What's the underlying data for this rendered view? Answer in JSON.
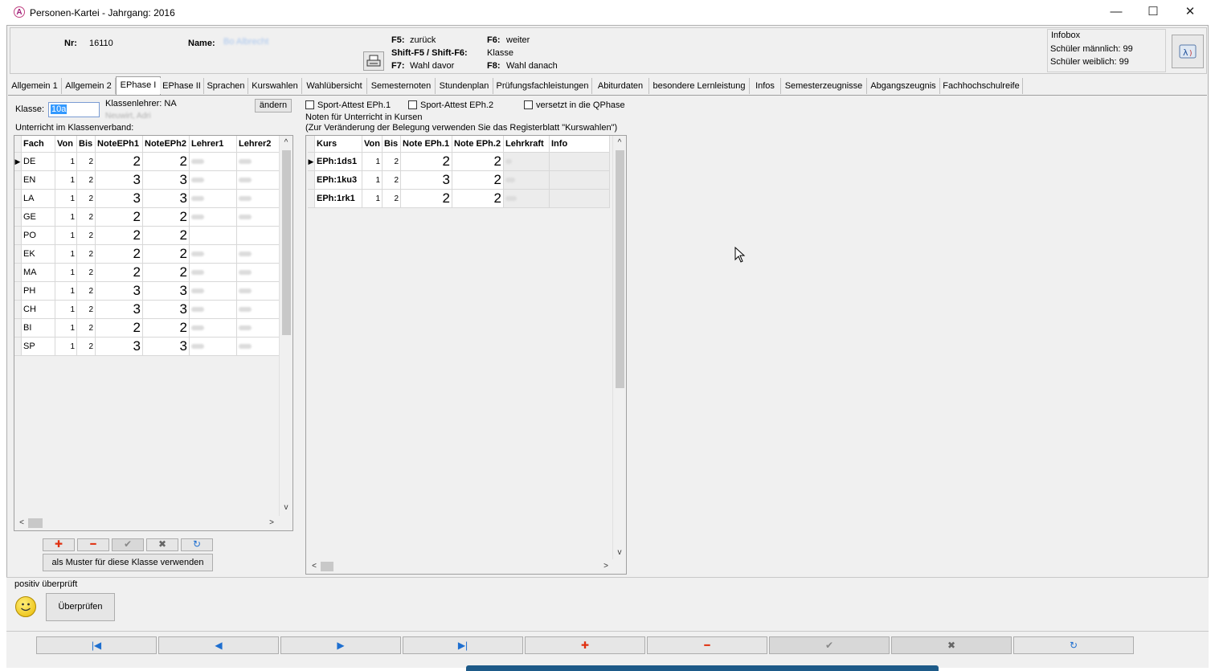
{
  "window": {
    "title": "Personen-Kartei - Jahrgang: 2016",
    "app_icon": "A",
    "minimize_icon": "—",
    "maximize_icon": "☐",
    "close_icon": "✕"
  },
  "header": {
    "nr_label": "Nr:",
    "nr_value": "16110",
    "name_label": "Name:",
    "name_value": "Bo Albrecht",
    "shortcuts": {
      "f5_key": "F5:",
      "f5_text": "zurück",
      "f6_key": "F6:",
      "f6_text": "weiter",
      "shift_key": "Shift-F5 / Shift-F6:",
      "shift_text": "Klasse",
      "f7_key": "F7:",
      "f7_text": "Wahl davor",
      "f8_key": "F8:",
      "f8_text": "Wahl danach"
    },
    "infobox": {
      "title": "Infobox",
      "male": "Schüler männlich: 99",
      "female": "Schüler weiblich: 99"
    }
  },
  "tabs": [
    "Allgemein 1",
    "Allgemein 2",
    "EPhase I",
    "EPhase II",
    "Sprachen",
    "Kurswahlen",
    "Wahlübersicht",
    "Semesternoten",
    "Stundenplan",
    "Prüfungsfachleistungen",
    "Abiturdaten",
    "besondere Lernleistung",
    "Infos",
    "Semesterzeugnisse",
    "Abgangszeugnis",
    "Fachhochschulreife"
  ],
  "active_tab": "EPhase I",
  "left": {
    "klasse_label": "Klasse:",
    "klasse_value": "10a",
    "klassenlehrer_label": "Klassenlehrer: NA",
    "klassenlehrer_sub": "Neuwirt, Adri",
    "aendern_label": "ändern",
    "section_label": "Unterricht im Klassenverband:",
    "columns": [
      "Fach",
      "Von",
      "Bis",
      "NoteEPh1",
      "NoteEPh2",
      "Lehrer1",
      "Lehrer2"
    ],
    "rows": [
      {
        "fach": "DE",
        "von": "1",
        "bis": "2",
        "n1": "2",
        "n2": "2"
      },
      {
        "fach": "EN",
        "von": "1",
        "bis": "2",
        "n1": "3",
        "n2": "3"
      },
      {
        "fach": "LA",
        "von": "1",
        "bis": "2",
        "n1": "3",
        "n2": "3"
      },
      {
        "fach": "GE",
        "von": "1",
        "bis": "2",
        "n1": "2",
        "n2": "2"
      },
      {
        "fach": "PO",
        "von": "1",
        "bis": "2",
        "n1": "2",
        "n2": "2"
      },
      {
        "fach": "EK",
        "von": "1",
        "bis": "2",
        "n1": "2",
        "n2": "2"
      },
      {
        "fach": "MA",
        "von": "1",
        "bis": "2",
        "n1": "2",
        "n2": "2"
      },
      {
        "fach": "PH",
        "von": "1",
        "bis": "2",
        "n1": "3",
        "n2": "3"
      },
      {
        "fach": "CH",
        "von": "1",
        "bis": "2",
        "n1": "3",
        "n2": "3"
      },
      {
        "fach": "BI",
        "von": "1",
        "bis": "2",
        "n1": "2",
        "n2": "2"
      },
      {
        "fach": "SP",
        "von": "1",
        "bis": "2",
        "n1": "3",
        "n2": "3"
      }
    ],
    "muster_label": "als Muster für diese Klasse verwenden"
  },
  "right": {
    "sport1_label": "Sport-Attest EPh.1",
    "sport2_label": "Sport-Attest EPh.2",
    "versetzt_label": "versetzt in die QPhase",
    "note_line1": "Noten für Unterricht in Kursen",
    "note_line2": "(Zur Veränderung der Belegung verwenden Sie das Registerblatt \"Kurswahlen\")",
    "columns": [
      "Kurs",
      "Von",
      "Bis",
      "Note EPh.1",
      "Note EPh.2",
      "Lehrkraft",
      "Info"
    ],
    "rows": [
      {
        "kurs": "EPh:1ds1",
        "von": "1",
        "bis": "2",
        "n1": "2",
        "n2": "2"
      },
      {
        "kurs": "EPh:1ku3",
        "von": "1",
        "bis": "2",
        "n1": "3",
        "n2": "2"
      },
      {
        "kurs": "EPh:1rk1",
        "von": "1",
        "bis": "2",
        "n1": "2",
        "n2": "2"
      }
    ]
  },
  "bottom": {
    "status": "positiv überprüft",
    "check_label": "Überprüfen"
  },
  "icons": {
    "add": "✚",
    "remove": "━",
    "confirm": "✔",
    "cancel": "✖",
    "refresh": "↻",
    "first": "|◀",
    "prev": "◀",
    "next": "▶",
    "last": "▶|",
    "up": "^",
    "down": "v",
    "left": "<",
    "right": ">",
    "row_pointer": "▶"
  },
  "colors": {
    "accent_blue": "#1e6fd0",
    "add_red": "#e03010",
    "remove_red": "#e03010"
  }
}
